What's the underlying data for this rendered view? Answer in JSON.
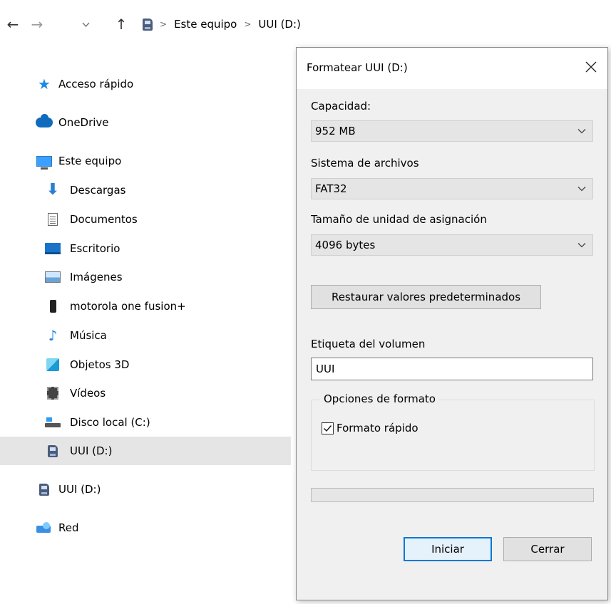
{
  "explorer": {
    "breadcrumbs": [
      "Este equipo",
      "UUI (D:)"
    ],
    "nav_items": [
      {
        "label": "Acceso rápido",
        "icon": "star-icon"
      },
      {
        "label": "OneDrive",
        "icon": "cloud-icon"
      },
      {
        "label": "Este equipo",
        "icon": "computer-icon"
      },
      {
        "label": "Descargas",
        "icon": "download-icon"
      },
      {
        "label": "Documentos",
        "icon": "document-icon"
      },
      {
        "label": "Escritorio",
        "icon": "desktop-icon"
      },
      {
        "label": "Imágenes",
        "icon": "pictures-icon"
      },
      {
        "label": "motorola one fusion+",
        "icon": "phone-icon"
      },
      {
        "label": "Música",
        "icon": "music-icon"
      },
      {
        "label": "Objetos 3D",
        "icon": "cube-3d-icon"
      },
      {
        "label": "Vídeos",
        "icon": "video-icon"
      },
      {
        "label": "Disco local (C:)",
        "icon": "local-disk-icon"
      },
      {
        "label": "UUI (D:)",
        "icon": "sd-drive-icon",
        "selected": true
      },
      {
        "label": "UUI (D:)",
        "icon": "sd-drive-icon"
      },
      {
        "label": "Red",
        "icon": "network-icon"
      }
    ]
  },
  "dialog": {
    "title": "Formatear UUI (D:)",
    "capacity_label": "Capacidad:",
    "capacity_value": "952 MB",
    "filesystem_label": "Sistema de archivos",
    "filesystem_value": "FAT32",
    "alloc_label": "Tamaño de unidad de asignación",
    "alloc_value": "4096 bytes",
    "restore_button": "Restaurar valores predeterminados",
    "volume_label_label": "Etiqueta del volumen",
    "volume_label_value": "UUI",
    "format_options_label": "Opciones de formato",
    "quick_format_label": "Formato rápido",
    "quick_format_checked": true,
    "progress_fraction": 0,
    "start_button": "Iniciar",
    "close_button": "Cerrar"
  },
  "colors": {
    "selection": "#e5e5e5",
    "accent": "#0078d7",
    "dialog_bg": "#f0f0f0"
  }
}
